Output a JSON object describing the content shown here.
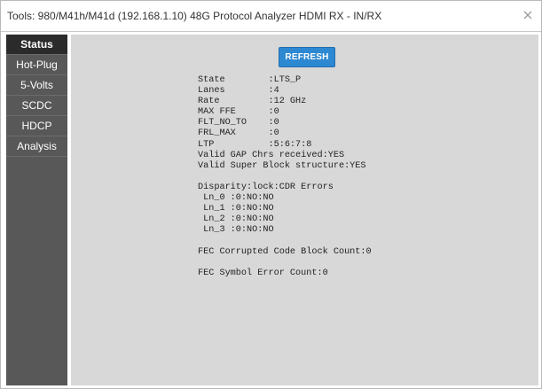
{
  "window": {
    "title": "Tools: 980/M41h/M41d (192.168.1.10) 48G Protocol Analyzer HDMI RX - IN/RX"
  },
  "sidebar": {
    "items": [
      {
        "label": "Status",
        "active": true
      },
      {
        "label": "Hot-Plug",
        "active": false
      },
      {
        "label": "5-Volts",
        "active": false
      },
      {
        "label": "SCDC",
        "active": false
      },
      {
        "label": "HDCP",
        "active": false
      },
      {
        "label": "Analysis",
        "active": false
      }
    ]
  },
  "main": {
    "refresh_label": "REFRESH",
    "status_lines": [
      "State        :LTS_P",
      "Lanes        :4",
      "Rate         :12 GHz",
      "MAX FFE      :0",
      "FLT_NO_TO    :0",
      "FRL_MAX      :0",
      "LTP          :5:6:7:8",
      "Valid GAP Chrs received:YES",
      "Valid Super Block structure:YES",
      "",
      "Disparity:lock:CDR Errors",
      " Ln_0 :0:NO:NO",
      " Ln_1 :0:NO:NO",
      " Ln_2 :0:NO:NO",
      " Ln_3 :0:NO:NO",
      "",
      "FEC Corrupted Code Block Count:0",
      "",
      "FEC Symbol Error Count:0"
    ]
  },
  "colors": {
    "sidebar_bg": "#585858",
    "sidebar_active": "#2b2b2b",
    "content_bg": "#d8d8d8",
    "accent": "#2d88d2"
  }
}
